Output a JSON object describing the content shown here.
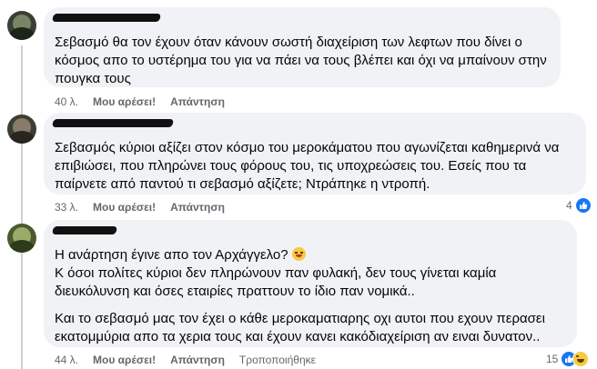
{
  "comments": [
    {
      "author": "",
      "text": [
        "Σεβασμό θα τον έχουν όταν κάνουν σωστή διαχείριση των λεφτων που δίνει ο κόσμος απο το υστέρημα του για να πάει να τους βλέπει και όχι να μπαίνουν στην πουγκα τους"
      ],
      "time": "40 λ.",
      "like_label": "Μου αρέσει!",
      "reply_label": "Απάντηση"
    },
    {
      "author": "",
      "text": [
        "Σεβασμός κύριοι αξίζει στον κόσμο του μεροκάματου που αγωνίζεται καθημερινά να επιβιώσει, που πληρώνει τους φόρους του, τις υποχρεώσεις του. Εσείς που τα παίρνετε από παντού τι σεβασμό αξίζετε; Ντράπηκε η ντροπή."
      ],
      "time": "33 λ.",
      "like_label": "Μου αρέσει!",
      "reply_label": "Απάντηση",
      "reaction_count": "4",
      "reaction_icons": [
        "like-icon"
      ]
    },
    {
      "author": "",
      "text": [
        "Η ανάρτηση έγινε απο τον Αρχάγγελο?",
        "Κ όσοι πολίτες κύριοι δεν πληρώνουν παν φυλακή, δεν τους γίνεται καμία διευκόλυνση και όσες εταιρίες πραττουν το ίδιο παν νομικά..",
        "Και το σεβασμό μας τον έχει ο κάθε μεροκαματιαρης οχι αυτοι που εχουν περασει εκατομμύρια απο τα χερια τους και έχουν κανει κακόδιαχείριση αν ειναι δυνατον.."
      ],
      "time": "44 λ.",
      "like_label": "Μου αρέσει!",
      "reply_label": "Απάντηση",
      "edited_label": "Τροποποιήθηκε",
      "reaction_count": "15",
      "reaction_icons": [
        "like-icon",
        "haha-icon"
      ]
    }
  ],
  "colors": {
    "bubble": "#f0f2f5",
    "meta_text": "#65676b",
    "like_blue": "#1877f2"
  }
}
